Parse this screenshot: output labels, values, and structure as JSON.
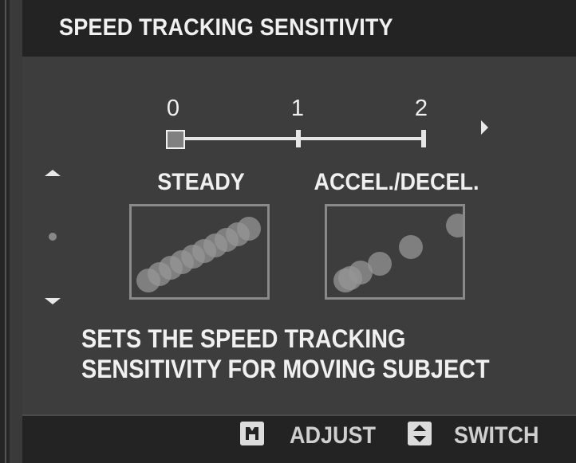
{
  "title": "SPEED TRACKING SENSITIVITY",
  "scale": {
    "labels": [
      "0",
      "1",
      "2"
    ],
    "selected": 0
  },
  "options": {
    "left": "STEADY",
    "right": "ACCEL./DECEL."
  },
  "description": {
    "line1": "SETS THE SPEED TRACKING",
    "line2": "SENSITIVITY FOR MOVING SUBJECT"
  },
  "footer": {
    "adjust_label": "ADJUST",
    "switch_label": "SWITCH"
  },
  "icons": {
    "adjust": "dial-icon",
    "switch": "selector-icon",
    "next": "arrow-right-icon",
    "up": "arrow-up-icon",
    "down": "arrow-down-icon"
  },
  "colors": {
    "accent": "#e8e8e8",
    "background": "#3d3d3d",
    "bar": "#232323"
  }
}
